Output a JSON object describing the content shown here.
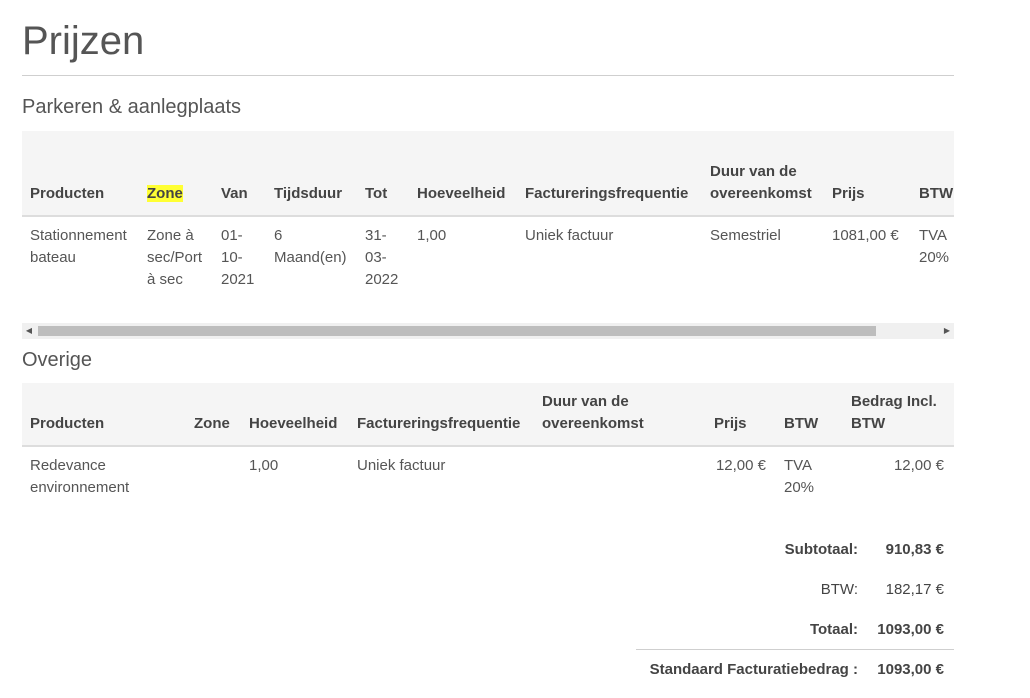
{
  "page": {
    "title": "Prijzen"
  },
  "parking": {
    "section_title": "Parkeren & aanlegplaats",
    "headers": {
      "producten": "Producten",
      "zone": "Zone",
      "van": "Van",
      "tijdsduur": "Tijdsduur",
      "tot": "Tot",
      "hoeveelheid": "Hoeveelheid",
      "frequentie": "Factureringsfrequentie",
      "duur_line1": "Duur van de",
      "duur_line2": "overeenkomst",
      "prijs": "Prijs",
      "btw": "BTW"
    },
    "row": {
      "producten_l1": "Stationnement",
      "producten_l2": "bateau",
      "zone_l1": "Zone à",
      "zone_l2": "sec/Port",
      "zone_l3": "à sec",
      "van_l1": "01-",
      "van_l2": "10-",
      "van_l3": "2021",
      "tijdsduur_l1": "6",
      "tijdsduur_l2": "Maand(en)",
      "tot_l1": "31-",
      "tot_l2": "03-",
      "tot_l3": "2022",
      "hoeveelheid": "1,00",
      "frequentie": "Uniek factuur",
      "duur": "Semestriel",
      "prijs": "1081,00 €",
      "btw_l1": "TVA",
      "btw_l2": "20%"
    },
    "highlight_color": "#ffff33"
  },
  "scrollbar": {
    "left_arrow": "◀",
    "right_arrow": "▶"
  },
  "other": {
    "section_title": "Overige",
    "headers": {
      "producten": "Producten",
      "zone": "Zone",
      "hoeveelheid": "Hoeveelheid",
      "frequentie": "Factureringsfrequentie",
      "duur_line1": "Duur van de",
      "duur_line2": "overeenkomst",
      "prijs": "Prijs",
      "btw": "BTW",
      "bedrag_line1": "Bedrag Incl.",
      "bedrag_line2": "BTW"
    },
    "row": {
      "producten_l1": "Redevance",
      "producten_l2": "environnement",
      "hoeveelheid": "1,00",
      "frequentie": "Uniek factuur",
      "prijs": "12,00 €",
      "btw_l1": "TVA",
      "btw_l2": "20%",
      "bedrag": "12,00 €"
    }
  },
  "totals": {
    "subtotaal_label": "Subtotaal:",
    "subtotaal_value": "910,83 €",
    "btw_label": "BTW:",
    "btw_value": "182,17 €",
    "totaal_label": "Totaal:",
    "totaal_value": "1093,00 €",
    "standaard_label": "Standaard Facturatiebedrag :",
    "standaard_value": "1093,00 €"
  }
}
